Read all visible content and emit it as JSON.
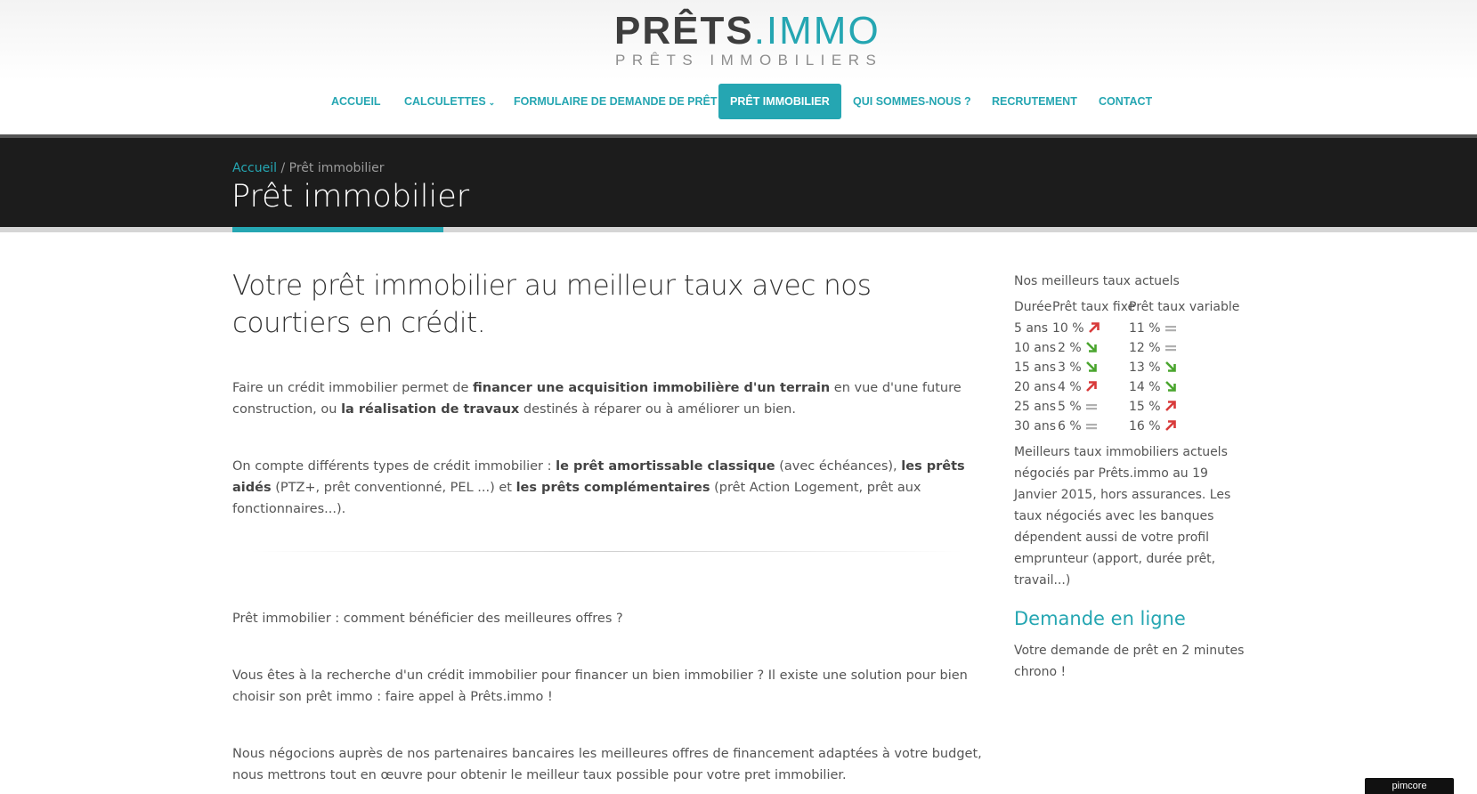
{
  "logo": {
    "word_prets": "PRÊTS",
    "word_immo": ".IMMO",
    "subtitle": "PRÊTS IMMOBILIERS"
  },
  "nav": [
    {
      "label": "ACCUEIL"
    },
    {
      "label": "CALCULETTES",
      "dropdown": true
    },
    {
      "label": "FORMULAIRE DE DEMANDE DE PRÊT"
    },
    {
      "label": "PRÊT IMMOBILIER",
      "active": true
    },
    {
      "label": "QUI SOMMES-NOUS ?"
    },
    {
      "label": "RECRUTEMENT"
    },
    {
      "label": "CONTACT"
    }
  ],
  "breadcrumb": {
    "home": "Accueil",
    "separator": " / ",
    "current": "Prêt immobilier"
  },
  "page_title": "Prêt immobilier",
  "main": {
    "heading": "Votre prêt immobilier au meilleur taux avec nos courtiers en crédit.",
    "p1": {
      "t1": "Faire un crédit immobilier permet de ",
      "b1": "financer une acquisition immobilière d'un terrain",
      "t2": " en vue d'une future construction, ou ",
      "b2": "la réalisation de travaux",
      "t3": " destinés à réparer ou à améliorer un bien."
    },
    "p2": {
      "t1": "On compte différents types de crédit immobilier : ",
      "b1": "le prêt amortissable classique",
      "t2": " (avec échéances), ",
      "b2": "les prêts aidés",
      "t3": " (PTZ+, prêt conventionné, PEL ...) et ",
      "b3": "les prêts complémentaires",
      "t4": " (prêt Action Logement, prêt aux fonctionnaires...)."
    },
    "p3": "Prêt immobilier : comment bénéficier des meilleures offres ?",
    "p4": "Vous êtes à la recherche d'un crédit immobilier pour financer un bien immobilier ? Il existe une solution pour bien choisir son prêt immo : faire appel à Prêts.immo !",
    "p5": "Nous négocions auprès de nos partenaires bancaires les meilleures offres de financement adaptées à votre budget, nous mettrons tout en œuvre pour obtenir le meilleur taux possible pour votre pret immobilier."
  },
  "sidebar": {
    "title": "Nos meilleurs taux actuels",
    "headers": {
      "duration": "Durée",
      "fixed": "Prêt taux fixe",
      "variable": "Prêt taux variable"
    },
    "rows": [
      {
        "duration": "5 ans",
        "fixed": "10 %",
        "fixed_trend": "up",
        "variable": "11 %",
        "variable_trend": "flat"
      },
      {
        "duration": "10 ans",
        "fixed": "2 %",
        "fixed_trend": "down",
        "variable": "12 %",
        "variable_trend": "flat"
      },
      {
        "duration": "15 ans",
        "fixed": "3 %",
        "fixed_trend": "down",
        "variable": "13 %",
        "variable_trend": "down"
      },
      {
        "duration": "20 ans",
        "fixed": "4 %",
        "fixed_trend": "up",
        "variable": "14 %",
        "variable_trend": "down"
      },
      {
        "duration": "25 ans",
        "fixed": "5 %",
        "fixed_trend": "flat",
        "variable": "15 %",
        "variable_trend": "up"
      },
      {
        "duration": "30 ans",
        "fixed": "6 %",
        "fixed_trend": "flat",
        "variable": "16 %",
        "variable_trend": "up"
      }
    ],
    "note": "Meilleurs taux immobiliers actuels négociés par Prêts.immo au 19 Janvier 2015, hors assurances. Les taux négociés avec les banques dépendent aussi de votre profil emprunteur (apport, durée prêt, travail...)",
    "online_title": "Demande en ligne",
    "online_text": "Votre demande de prêt en 2 minutes chrono !"
  },
  "footer_badge": "pimcore",
  "colors": {
    "accent": "#25a6b2",
    "dark_band": "#1c1c1c",
    "trend_up": "#d83a3a",
    "trend_down": "#4aa52e",
    "trend_flat": "#b0b0b0"
  }
}
